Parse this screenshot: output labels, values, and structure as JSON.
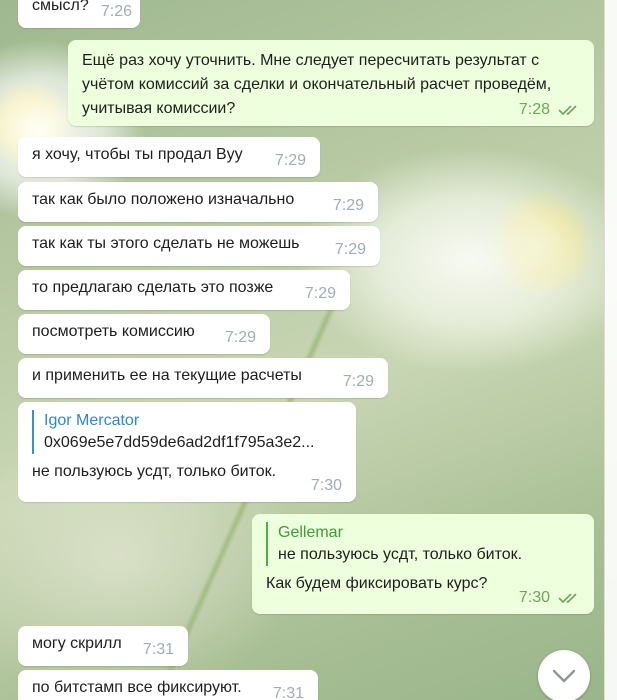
{
  "chat": {
    "messages": [
      {
        "direction": "in",
        "text": "смысл?",
        "time": "7:26"
      },
      {
        "direction": "out",
        "text": "Ещё раз хочу уточнить. Мне следует пересчитать результат с учётом комиссий за сделки и окончательный расчет проведём, учитывая комиссии?",
        "time": "7:28",
        "read": true
      },
      {
        "direction": "in",
        "text": "я хочу, чтобы ты продал Byy",
        "time": "7:29"
      },
      {
        "direction": "in",
        "text": "так как было положено изначально",
        "time": "7:29"
      },
      {
        "direction": "in",
        "text": "так как ты этого сделать не можешь",
        "time": "7:29"
      },
      {
        "direction": "in",
        "text": "то предлагаю сделать это позже",
        "time": "7:29"
      },
      {
        "direction": "in",
        "text": "посмотреть комиссию",
        "time": "7:29"
      },
      {
        "direction": "in",
        "text": "и применить ее на текущие расчеты",
        "time": "7:29"
      },
      {
        "direction": "in",
        "reply": {
          "name": "Igor Mercator",
          "text": "0x069e5e7dd59de6ad2df1f795a3e2..."
        },
        "text": "не пользуюсь усдт, только биток.",
        "time": "7:30"
      },
      {
        "direction": "out",
        "reply": {
          "name": "Gellemar",
          "text": "не пользуюсь усдт, только биток."
        },
        "text": "Как будем фиксировать курс?",
        "time": "7:30",
        "read": true
      },
      {
        "direction": "in",
        "text": "могу скрилл",
        "time": "7:31"
      },
      {
        "direction": "in",
        "text": "по битстамп все фиксируют.",
        "time": "7:31"
      }
    ]
  },
  "icons": {
    "read_receipt": "double-check-icon",
    "scroll_down": "chevron-down-icon"
  },
  "colors": {
    "incoming_bubble": "#ffffff",
    "outgoing_bubble": "#eeffde",
    "outgoing_time": "#6ca65a",
    "incoming_time": "#a0acb6",
    "reply_in_accent": "#2e87d0",
    "reply_out_accent": "#3f9a3d"
  }
}
